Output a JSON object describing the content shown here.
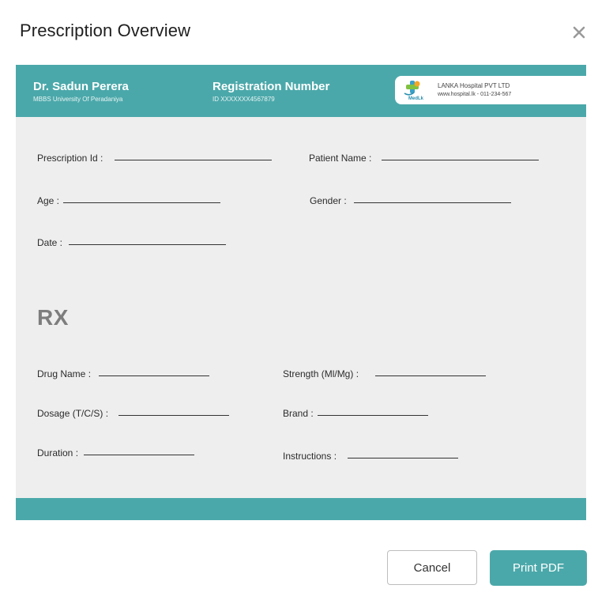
{
  "dialog": {
    "title": "Prescription Overview",
    "close_icon": "close-icon"
  },
  "header": {
    "doctor_name": "Dr. Sadun Perera",
    "doctor_qualification": "MBBS  University Of Peradaniya",
    "registration_title": "Registration Number",
    "registration_id": "ID XXXXXXX4567879",
    "hospital_logo_text": "MedLk",
    "hospital_name": "LANKA Hospital PVT LTD",
    "hospital_contact": "www.hospital.lk  - 011-234-567"
  },
  "fields": {
    "prescription_id": "Prescription Id :",
    "patient_name": "Patient Name :",
    "age": "Age :",
    "gender": "Gender :",
    "date": "Date :"
  },
  "rx": {
    "title": "RX",
    "drug_name": "Drug Name :",
    "strength": "Strength (Ml/Mg) :",
    "dosage": "Dosage (T/C/S) :",
    "brand": "Brand :",
    "duration": "Duration :",
    "instructions": "Instructions :"
  },
  "actions": {
    "cancel_label": "Cancel",
    "print_label": "Print PDF"
  },
  "colors": {
    "accent": "#4ba8aa",
    "sheet_background": "#eeeeee"
  }
}
